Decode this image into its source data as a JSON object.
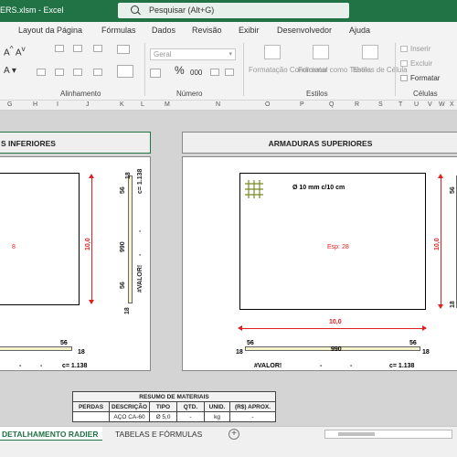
{
  "titlebar": {
    "filename": "ERS.xlsm  -  Excel",
    "search_placeholder": "Pesquisar (Alt+G)"
  },
  "ribbon_tabs": [
    "Layout da Página",
    "Fórmulas",
    "Dados",
    "Revisão",
    "Exibir",
    "Desenvolvedor",
    "Ajuda"
  ],
  "ribbon": {
    "number_format": "Geral",
    "percent_symbol": "%",
    "thousands_symbol": "000",
    "groups": {
      "alignment": "Alinhamento",
      "number": "Número",
      "styles": "Estilos",
      "cells": "Células"
    },
    "buttons": {
      "conditional_formatting": "Formatação Condicional",
      "format_as_table": "Formatar como Tabela",
      "cell_styles": "Estilos de Célula",
      "insert": "Inserir",
      "delete": "Excluir",
      "format": "Formatar"
    }
  },
  "columns": [
    "G",
    "H",
    "I",
    "J",
    "K",
    "L",
    "M",
    "N",
    "O",
    "P",
    "Q",
    "R",
    "S",
    "T",
    "U",
    "V",
    "W",
    "X"
  ],
  "sheet": {
    "left_panel": {
      "title": "S INFERIORES",
      "spacing_label": "8",
      "dim_vertical": "10,0",
      "top_hook": "18",
      "dim_56_top": "56",
      "dim_990": "990",
      "dim_56_bottom": "56",
      "dim_18_bottom": "18",
      "valor": "#VALOR!",
      "dash1": "-",
      "dash2": "-",
      "c_value": "c= 1.138",
      "bottom_56": "56",
      "bottom_18": "18",
      "bottom_dash1": "-",
      "bottom_dash2": "-",
      "bottom_c": "c= 1.138"
    },
    "right_panel": {
      "title": "ARMADURAS SUPERIORES",
      "bar_spec": "Ø 10 mm c/10 cm",
      "thickness": "Esp: 28",
      "dim_vertical": "10,0",
      "dim_horizontal": "10,0",
      "left_56": "56",
      "left_18": "18",
      "mid_990": "990",
      "right_56": "56",
      "right_18": "18",
      "valor": "#VALOR!",
      "dash1": "-",
      "dash2": "-",
      "c_value": "c= 1.138",
      "side_18": "18",
      "side_56_top": "56"
    }
  },
  "materials": {
    "title": "RESUMO DE MATERIAIS",
    "headers": [
      "PERDAS",
      "DESCRIÇÃO",
      "TIPO",
      "QTD.",
      "UNID.",
      "(R$) APROX."
    ],
    "row": [
      "",
      "AÇO CA-60",
      "Ø 5,0",
      "-",
      "kg",
      "-"
    ]
  },
  "sheet_tabs": {
    "active": "DETALHAMENTO RADIER",
    "other": "TABELAS E FÓRMULAS",
    "add": "+"
  },
  "colors": {
    "excel_green": "#217346",
    "dimension_red": "#e02020"
  }
}
